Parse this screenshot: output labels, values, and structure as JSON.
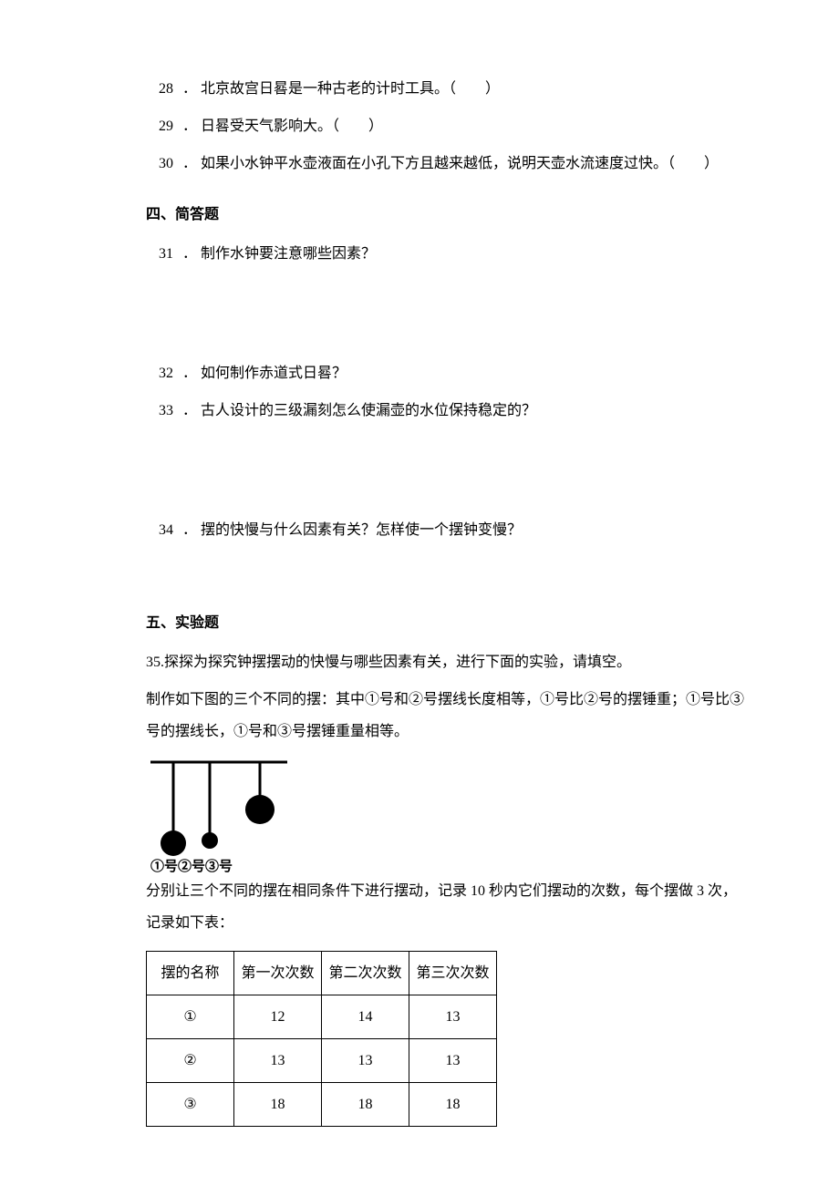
{
  "q28": {
    "num": "28",
    "dot": "．",
    "text": "北京故宫日晷是一种古老的计时工具。（　　）"
  },
  "q29": {
    "num": "29",
    "dot": "．",
    "text": "日晷受天气影响大。（　　）"
  },
  "q30": {
    "num": "30",
    "dot": "．",
    "text": "如果小水钟平水壶液面在小孔下方且越来越低，说明天壶水流速度过快。（　　）"
  },
  "section4": "四、简答题",
  "q31": {
    "num": "31",
    "dot": "．",
    "text": "制作水钟要注意哪些因素？"
  },
  "q32": {
    "num": "32",
    "dot": "．",
    "text": "如何制作赤道式日晷？"
  },
  "q33": {
    "num": "33",
    "dot": "．",
    "text": "古人设计的三级漏刻怎么使漏壶的水位保持稳定的？"
  },
  "q34": {
    "num": "34",
    "dot": "．",
    "text": "摆的快慢与什么因素有关？怎样使一个摆钟变慢？"
  },
  "section5": "五、实验题",
  "q35_intro": "35.探探为探究钟摆摆动的快慢与哪些因素有关，进行下面的实验，请填空。",
  "q35_p1": "制作如下图的三个不同的摆：其中①号和②号摆线长度相等，①号比②号的摆锤重；①号比③号的摆线长，①号和③号摆锤重量相等。",
  "q35_caption": "①号②号③号",
  "q35_p2": "分别让三个不同的摆在相同条件下进行摆动，记录 10 秒内它们摆动的次数，每个摆做 3 次，记录如下表：",
  "chart_data": {
    "type": "table",
    "columns": [
      "摆的名称",
      "第一次次数",
      "第二次次数",
      "第三次次数"
    ],
    "rows": [
      {
        "name": "①",
        "v1": "12",
        "v2": "14",
        "v3": "13"
      },
      {
        "name": "②",
        "v1": "13",
        "v2": "13",
        "v3": "13"
      },
      {
        "name": "③",
        "v1": "18",
        "v2": "18",
        "v3": "18"
      }
    ]
  }
}
